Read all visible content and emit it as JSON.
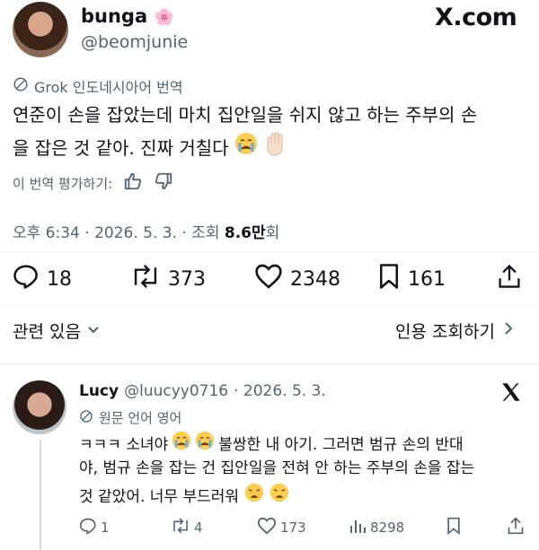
{
  "tweet": {
    "author_name": "bunga",
    "author_emoji": "🌸",
    "author_handle": "@beomjunie",
    "brand": "X.com",
    "translation_label": "Grok 인도네시아어 번역",
    "text_line1": "연준이 손을 잡았는데 마치 집안일을 쉬지 않고 하는 주부의 손",
    "text_line2": "을 잡은 것 같아. 진짜 거칠다",
    "rate_label": "이 번역 평가하기:",
    "timestamp": "오후 6:34 · 2026. 5. 3. · 조회 ",
    "views": "8.6만",
    "views_suffix": "회",
    "replies": "18",
    "reposts": "373",
    "likes": "2348",
    "bookmarks": "161",
    "related_label": "관련 있음",
    "quote_label": "인용 조회하기"
  },
  "reply": {
    "author_name": "Lucy",
    "author_handle": "@luucyy0716",
    "date": "· 2026. 5. 3.",
    "translation_label": "원문 언어 영어",
    "line1_a": "ㅋㅋㅋ 소녀야",
    "line1_b": "불쌍한 내 아기. 그러면 범규 손의 반대",
    "line2": "야, 범규 손을 잡는 건 집안일을 전혀 안 하는 주부의 손을 잡는",
    "line3": "것 같았어. 너무 부드러워",
    "replies": "1",
    "reposts": "4",
    "likes": "173",
    "views": "8298"
  },
  "icons": [
    "translate-icon",
    "thumbs-up-icon",
    "thumbs-down-icon",
    "reply-icon",
    "repost-icon",
    "like-icon",
    "bookmark-icon",
    "share-icon",
    "chevron-down-icon",
    "chevron-right-icon",
    "x-logo-icon",
    "views-icon",
    "crying-emoji",
    "raised-hand-emoji",
    "weary-emoji"
  ],
  "colors": {
    "text": "#0f1419",
    "secondary": "#536471",
    "divider": "#eff3f4"
  }
}
